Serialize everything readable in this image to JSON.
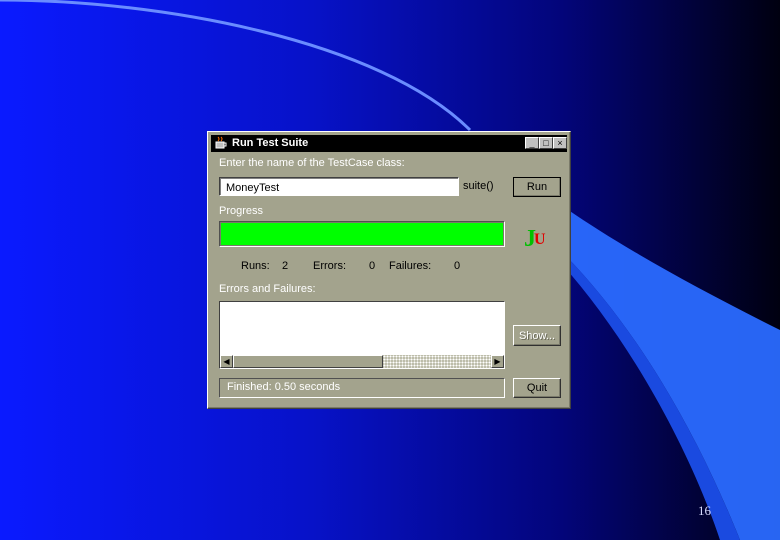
{
  "slide": {
    "page_number": "16"
  },
  "window": {
    "title": "Run Test Suite",
    "controls": {
      "minimize": "_",
      "maximize": "□",
      "close": "×"
    }
  },
  "test_class": {
    "prompt": "Enter the name of the TestCase class:",
    "value": "MoneyTest",
    "suffix": "suite()",
    "run_label": "Run"
  },
  "progress": {
    "label": "Progress",
    "fraction": 1.0,
    "color": "#00ff00",
    "logo_j": "J",
    "logo_u": "U"
  },
  "stats": {
    "runs_label": "Runs:",
    "runs_value": "2",
    "errors_label": "Errors:",
    "errors_value": "0",
    "failures_label": "Failures:",
    "failures_value": "0"
  },
  "errors_panel": {
    "label": "Errors and Failures:",
    "show_label": "Show...",
    "scroll_left": "◀",
    "scroll_right": "▶"
  },
  "status": {
    "text": "Finished: 0.50 seconds",
    "quit_label": "Quit"
  },
  "colors": {
    "window_face": "#a3a38d",
    "titlebar": "#000000",
    "background_accent": "#0a1aff"
  }
}
